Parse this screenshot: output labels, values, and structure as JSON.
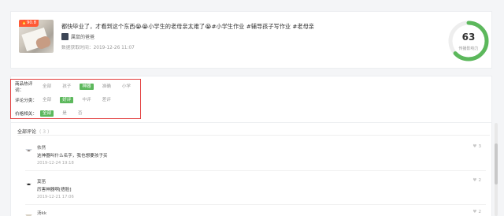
{
  "article": {
    "badge": "90.8",
    "title": "都快毕业了，才看到这个东西😭😭小学生的老母亲太难了😭#小学生作业 #辅导孩子写作业 #老母亲",
    "author": "属鼠的爸爸",
    "date": "数据获取时间：2019-12-26 11:07",
    "score": "63",
    "score_label": "传播影响力",
    "score_fraction": 0.63,
    "ring_color": "#5cb85c"
  },
  "filters": [
    {
      "label": "商品热评词：",
      "options": [
        "全部",
        "孩子",
        "神器",
        "准确",
        "小学"
      ],
      "active": 2
    },
    {
      "label": "评论分类：",
      "options": [
        "全部",
        "好评",
        "中评",
        "差评"
      ],
      "active": 1
    },
    {
      "label": "价格相关：",
      "options": [
        "全部",
        "是",
        "否"
      ],
      "active": 0
    }
  ],
  "comments_section": {
    "title": "全部评论",
    "count": "( 3 )"
  },
  "comments": [
    {
      "name": "依然",
      "text": "这神器叫什么名字，我也想要孩子买",
      "time": "2019-12-24 19:18",
      "likes": "3"
    },
    {
      "name": "莫笛",
      "text": "厉害神器啊[捂脸]",
      "time": "2019-12-21 17:06",
      "likes": "2"
    },
    {
      "name": "汤kk",
      "text": "",
      "time": "",
      "likes": "2"
    }
  ],
  "accent_color": "#5cb85c",
  "highlight_color": "#e23d3d"
}
